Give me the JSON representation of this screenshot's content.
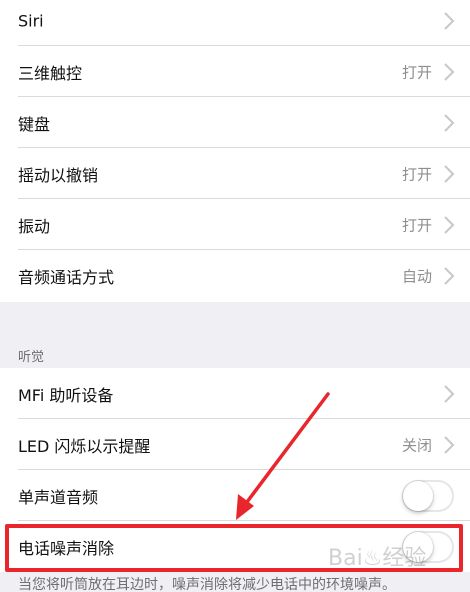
{
  "rows_top": [
    {
      "label": "Siri",
      "value": "",
      "control": "chevron"
    },
    {
      "label": "三维触控",
      "value": "打开",
      "control": "chevron"
    },
    {
      "label": "键盘",
      "value": "",
      "control": "chevron"
    },
    {
      "label": "摇动以撤销",
      "value": "打开",
      "control": "chevron"
    },
    {
      "label": "振动",
      "value": "打开",
      "control": "chevron"
    },
    {
      "label": "音频通话方式",
      "value": "自动",
      "control": "chevron"
    }
  ],
  "section_header": "听觉",
  "rows_hearing": [
    {
      "label": "MFi 助听设备",
      "value": "",
      "control": "chevron"
    },
    {
      "label": "LED 闪烁以示提醒",
      "value": "关闭",
      "control": "chevron"
    },
    {
      "label": "单声道音频",
      "value": "",
      "control": "toggle",
      "toggle_on": false
    },
    {
      "label": "电话噪声消除",
      "value": "",
      "control": "toggle",
      "toggle_on": false
    }
  ],
  "footer_text": "当您将听筒放在耳边时，噪声消除将减少电话中的环境噪声。",
  "annotation": {
    "color": "#e8262b"
  }
}
